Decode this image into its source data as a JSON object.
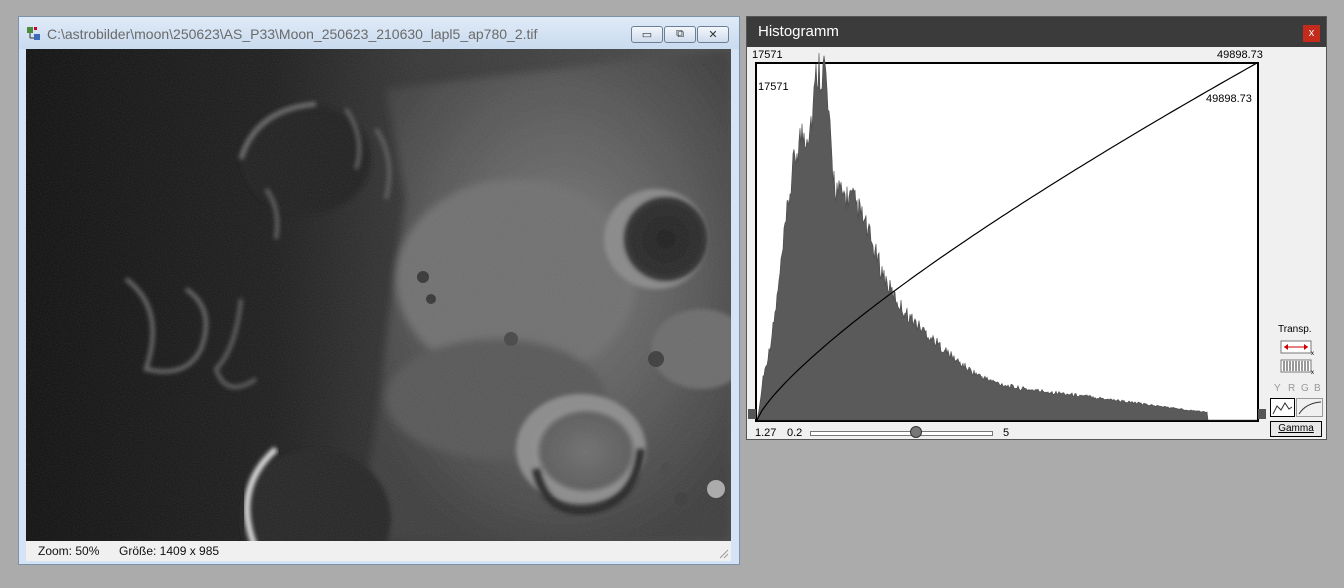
{
  "image_window": {
    "title": "C:\\astrobilder\\moon\\250623\\AS_P33\\Moon_250623_210630_lapl5_ap780_2.tif",
    "status": {
      "zoom": "Zoom: 50%",
      "size": "Größe: 1409 x 985"
    },
    "buttons": {
      "minimize": "▭",
      "restore": "⧉",
      "close": "✕"
    }
  },
  "histogram_window": {
    "title": "Histogramm",
    "close": "x",
    "top_left_value": "17571",
    "top_right_value": "49898.73",
    "inner_left_value": "17571",
    "inner_right_value": "49898.73",
    "gamma_value": "1.27",
    "slider_min": "0.2",
    "slider_max": "5",
    "slider_position": 0.58,
    "transp_label": "Transp.",
    "channels": [
      "Y",
      "R",
      "G",
      "B"
    ],
    "gamma_button": "Gamma"
  }
}
